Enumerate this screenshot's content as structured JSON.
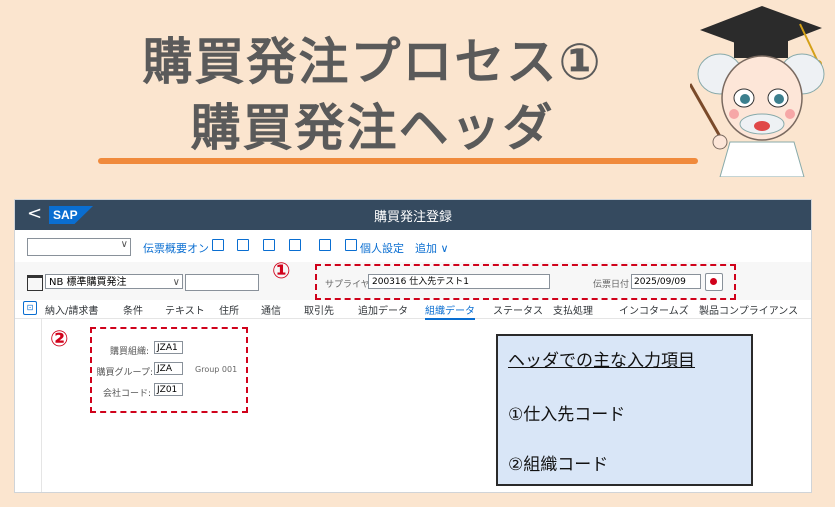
{
  "slide": {
    "title_line1": "購買発注プロセス①",
    "title_line2": "購買発注ヘッダ",
    "accent_color": "#f08a3c"
  },
  "sap": {
    "back": "<",
    "logo": "SAP",
    "app_title": "購買発注登録",
    "toolbar": {
      "select_value": "",
      "doc_overview": "伝票概要オン",
      "personal_settings": "個人設定",
      "more": "追加 ∨"
    },
    "header": {
      "doc_type": "NB 標準購買発注",
      "doc_number": "",
      "supplier_label": "サプライヤ:",
      "supplier_value": "200316 仕入先テスト1",
      "date_label": "伝票日付",
      "date_value": "2025/09/09"
    },
    "tabs": [
      "納入/請求書",
      "条件",
      "テキスト",
      "住所",
      "通信",
      "取引先",
      "追加データ",
      "組織データ",
      "ステータス",
      "支払処理",
      "インコタームズ",
      "製品コンプライアンス"
    ],
    "active_tab": "組織データ",
    "org": {
      "purch_org_label": "購買組織:",
      "purch_org_value": "JZA1",
      "purch_group_label": "購買グループ:",
      "purch_group_value": "JZA",
      "purch_group_desc": "Group 001",
      "company_label": "会社コード:",
      "company_value": "JZ01"
    }
  },
  "annotations": {
    "marker1": "①",
    "marker2": "②",
    "highlight_color": "#d0021b"
  },
  "info_box": {
    "title": "ヘッダでの主な入力項目",
    "item1": "①仕入先コード",
    "item2": "②組織コード"
  }
}
